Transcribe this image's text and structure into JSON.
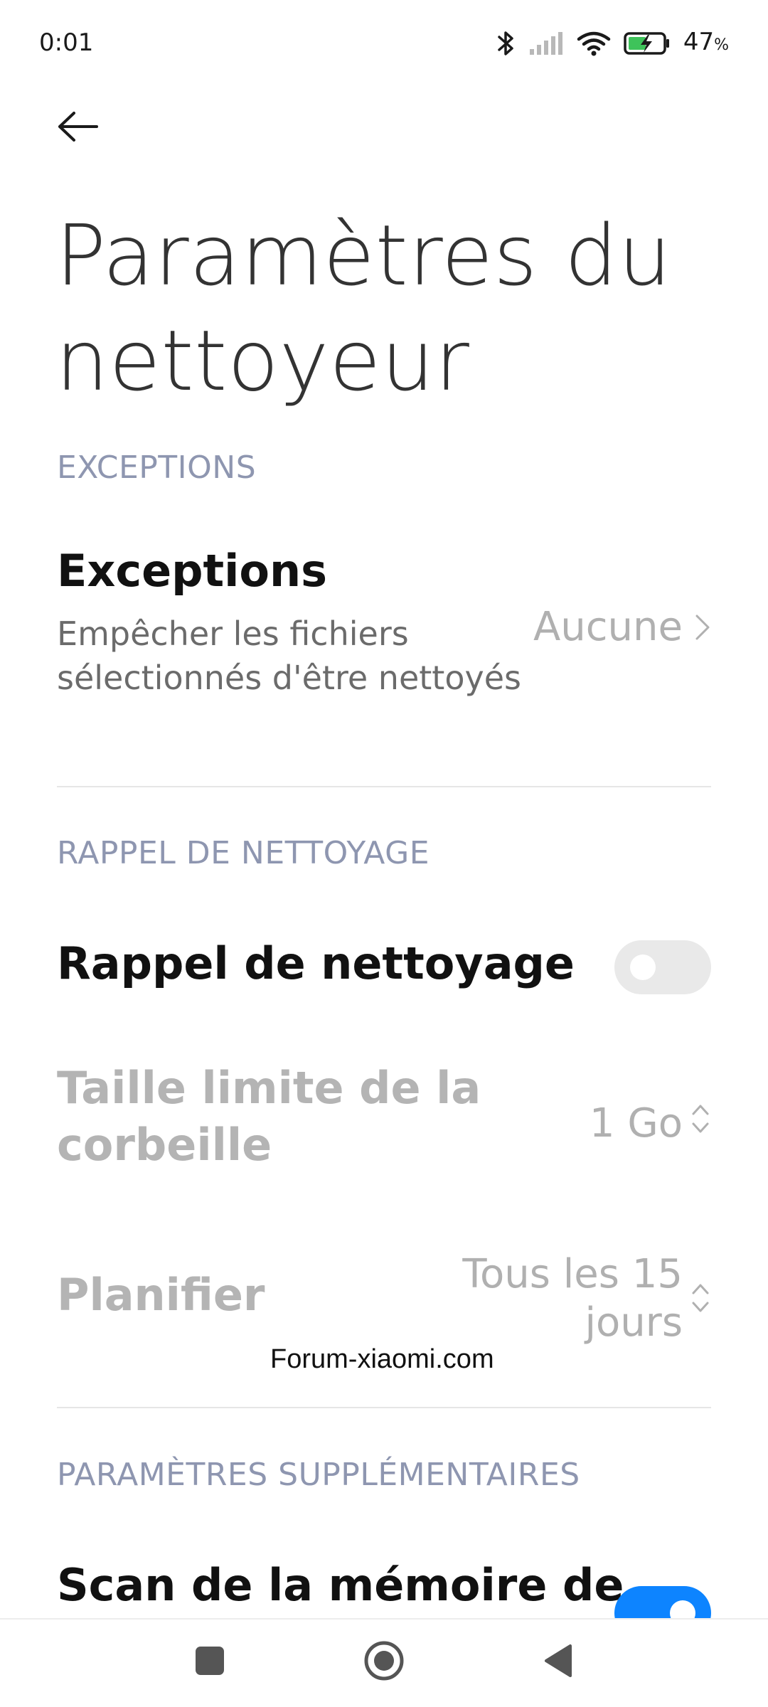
{
  "status_bar": {
    "time": "0:01",
    "battery_percent": "47",
    "battery_unit": "%",
    "icons": [
      "bluetooth-icon",
      "signal-icon",
      "wifi-icon",
      "battery-charging-icon"
    ]
  },
  "header": {
    "back_icon": "arrow-left-icon",
    "title": "Paramètres du nettoyeur"
  },
  "sections": {
    "exceptions": {
      "header": "EXCEPTIONS",
      "row": {
        "title": "Exceptions",
        "subtitle": "Empêcher les fichiers sélectionnés d'être nettoyés",
        "value": "Aucune"
      }
    },
    "reminder": {
      "header": "RAPPEL DE NETTOYAGE",
      "toggle_row": {
        "title": "Rappel de nettoyage",
        "enabled": false
      },
      "size_row": {
        "title": "Taille limite de la corbeille",
        "value": "1 Go"
      },
      "schedule_row": {
        "title": "Planifier",
        "value": "Tous les 15 jours"
      }
    },
    "extra": {
      "header": "PARAMÈTRES SUPPLÉMENTAIRES",
      "scan_row": {
        "title": "Scan de la mémoire de",
        "enabled": true
      }
    }
  },
  "watermark": "Forum-xiaomi.com",
  "nav_bar": {
    "icons": [
      "recents-square-icon",
      "home-circle-icon",
      "back-triangle-icon"
    ]
  },
  "colors": {
    "accent": "#0d84ff",
    "section_header": "#8e96b0",
    "disabled_text": "#b4b4b4"
  }
}
